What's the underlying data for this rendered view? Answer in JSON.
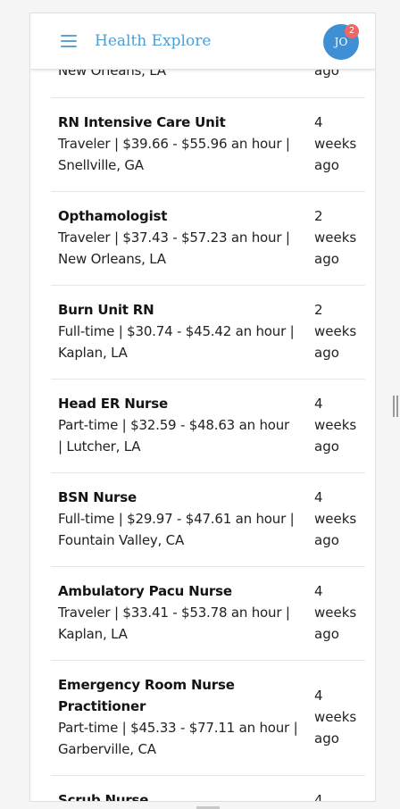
{
  "header": {
    "title": "Health Explore",
    "avatar_initials": "JO",
    "notification_count": "2"
  },
  "partial_top": {
    "details_fragment": "New Orleans, LA",
    "time_fragment": "ago"
  },
  "jobs": [
    {
      "title": "RN Intensive Care Unit",
      "details": [
        "Traveler | $39.66 - $55.96 an hour |",
        "Snellville, GA"
      ],
      "time": [
        "4",
        "weeks",
        "ago"
      ]
    },
    {
      "title": "Opthamologist",
      "details": [
        "Traveler | $37.43 - $57.23 an hour |",
        "New Orleans, LA"
      ],
      "time": [
        "2",
        "weeks",
        "ago"
      ]
    },
    {
      "title": "Burn Unit RN",
      "details": [
        "Full-time | $30.74 - $45.42 an hour |",
        "Kaplan, LA"
      ],
      "time": [
        "2",
        "weeks",
        "ago"
      ]
    },
    {
      "title": "Head ER Nurse",
      "details": [
        "Part-time | $32.59 - $48.63 an hour",
        "| Lutcher, LA"
      ],
      "time": [
        "4",
        "weeks",
        "ago"
      ]
    },
    {
      "title": "BSN Nurse",
      "details": [
        "Full-time | $29.97 - $47.61 an hour |",
        "Fountain Valley, CA"
      ],
      "time": [
        "4",
        "weeks",
        "ago"
      ]
    },
    {
      "title": "Ambulatory Pacu Nurse",
      "details": [
        "Traveler | $33.41 - $53.78 an hour |",
        "Kaplan, LA"
      ],
      "time": [
        "4",
        "weeks",
        "ago"
      ]
    },
    {
      "title_lines": [
        "Emergency Room Nurse",
        "Practitioner"
      ],
      "details": [
        "Part-time | $45.33 - $77.11 an hour |",
        "Garberville, CA"
      ],
      "time": [
        "4",
        "weeks",
        "ago"
      ]
    }
  ],
  "partial_bottom": {
    "title": "Scrub Nurse",
    "time": "4"
  },
  "colors": {
    "accent": "#4a9fd6",
    "avatar_bg": "#3f8fd4",
    "badge_bg": "#f06565"
  },
  "icons": {
    "menu": "hamburger-menu-icon",
    "scroll": "scroll-grip-icon"
  }
}
